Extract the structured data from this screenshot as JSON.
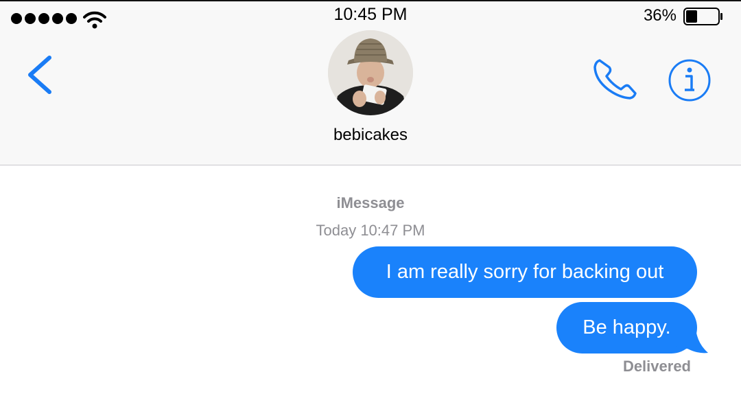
{
  "status_bar": {
    "time": "10:45 PM",
    "battery_percent": "36%",
    "battery_level": 0.36,
    "signal_bars": 5,
    "icons": [
      "signal-dots-icon",
      "wifi-icon",
      "battery-icon"
    ]
  },
  "nav": {
    "back_icon": "chevron-left-icon",
    "contact_name": "bebicakes",
    "avatar": "contact-avatar",
    "call_icon": "phone-icon",
    "info_icon": "info-icon",
    "accent_color": "#1a7cf5"
  },
  "thread": {
    "service": "iMessage",
    "timestamp": "Today 10:47 PM",
    "bubble_color": "#1a82fb",
    "messages": [
      {
        "text": "I am really sorry for backing out",
        "sender": "me"
      },
      {
        "text": "Be happy.",
        "sender": "me"
      }
    ],
    "delivery_status": "Delivered"
  }
}
